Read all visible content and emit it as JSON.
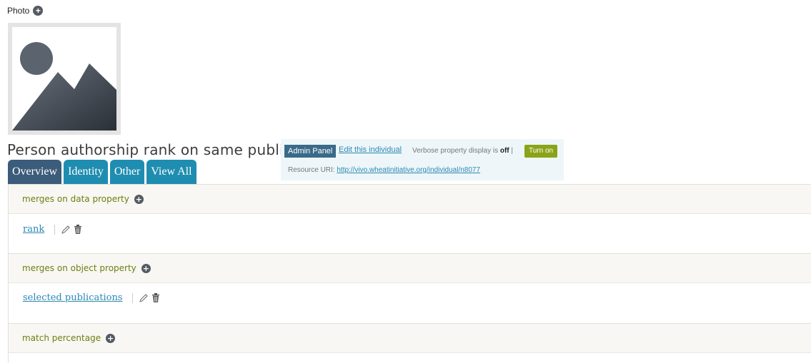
{
  "photo": {
    "label": "Photo",
    "add_icon": "plus-circle-icon",
    "placeholder_icon": "image-placeholder-icon"
  },
  "page_title": "Person authorship rank on same publication",
  "tabs": [
    {
      "label": "Overview",
      "active": true
    },
    {
      "label": "Identity",
      "active": false
    },
    {
      "label": "Other",
      "active": false
    },
    {
      "label": "View All",
      "active": false
    }
  ],
  "admin": {
    "panel_label": "Admin Panel",
    "edit_label": "Edit this individual",
    "verbose_prefix": "Verbose property display is",
    "verbose_state": "off",
    "turn_on_label": "Turn on",
    "resource_uri_label": "Resource URI:",
    "resource_uri": "http://vivo.wheatinitiative.org/individual/n8077"
  },
  "groups": [
    {
      "title": "merges on data property",
      "items": [
        {
          "label": "rank"
        }
      ]
    },
    {
      "title": "merges on object property",
      "items": [
        {
          "label": "selected publications"
        }
      ]
    },
    {
      "title": "match percentage",
      "items": []
    }
  ],
  "colors": {
    "tab": "#1f8db0",
    "tab_active": "#3b5c7a",
    "link": "#2b89b4",
    "group_title": "#6d7f12",
    "turn_on": "#8aa318"
  }
}
